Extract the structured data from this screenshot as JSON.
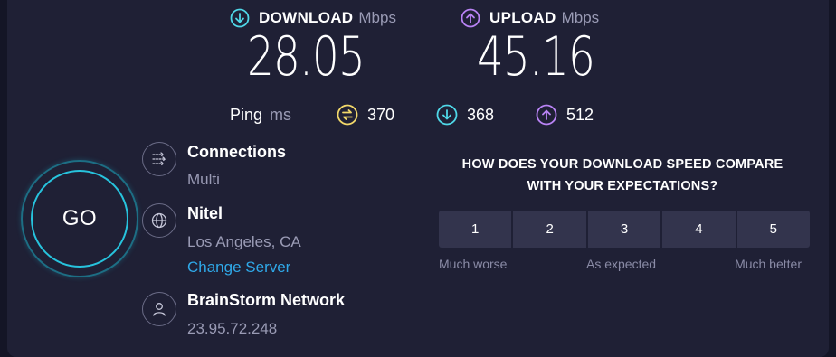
{
  "download": {
    "label": "DOWNLOAD",
    "unit": "Mbps",
    "value": "28.05"
  },
  "upload": {
    "label": "UPLOAD",
    "unit": "Mbps",
    "value": "45.16"
  },
  "ping": {
    "label": "Ping",
    "unit": "ms",
    "idle": "370",
    "download": "368",
    "upload": "512"
  },
  "go_button": {
    "label": "GO"
  },
  "connections": {
    "title": "Connections",
    "value": "Multi"
  },
  "server": {
    "title": "Nitel",
    "location": "Los Angeles, CA",
    "change_label": "Change Server"
  },
  "provider": {
    "title": "BrainStorm Network",
    "ip": "23.95.72.248"
  },
  "survey": {
    "question_line1": "HOW DOES YOUR DOWNLOAD SPEED COMPARE",
    "question_line2": "WITH YOUR EXPECTATIONS?",
    "ratings": [
      "1",
      "2",
      "3",
      "4",
      "5"
    ],
    "scale": {
      "low": "Much worse",
      "mid": "As expected",
      "high": "Much better"
    }
  },
  "colors": {
    "background": "#1f2035",
    "download_accent": "#4fd8e8",
    "upload_accent": "#b983f5",
    "ping_accent": "#f2d86a",
    "link": "#2fa8e8",
    "go_ring": "#27c3dd"
  },
  "icons": {
    "download": "arrow-down-circle",
    "upload": "arrow-up-circle",
    "ping_idle": "exchange-circle",
    "connections": "multi-arrow-right",
    "server": "globe",
    "provider": "person"
  }
}
